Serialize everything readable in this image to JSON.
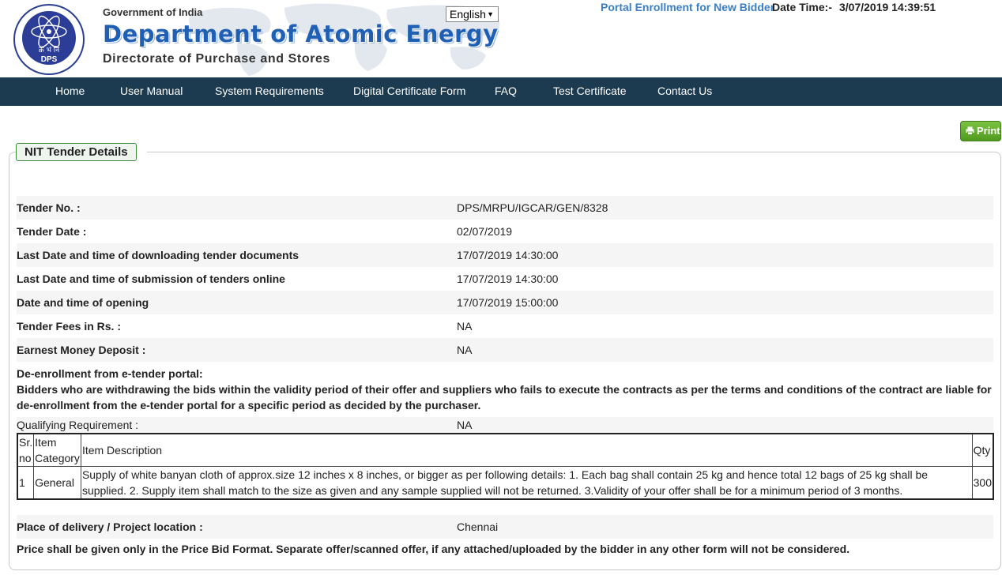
{
  "header": {
    "logo_alt": "DPS",
    "gov_text": "Government of India",
    "dept_title": "Department of Atomic Energy",
    "directorate": "Directorate of Purchase and Stores",
    "language": "English",
    "enrollment_link": "Portal Enrollment for New Bidder",
    "date_time_label": "Date Time:-",
    "date_time_value": "3/07/2019 14:39:51"
  },
  "nav": [
    "Home",
    "User Manual",
    "System Requirements",
    "Digital Certificate Form",
    "FAQ",
    "Test Certificate",
    "Contact Us"
  ],
  "print_label": "Print",
  "panel_title": "NIT Tender Details",
  "details": [
    {
      "label": "Tender No. :",
      "value": "DPS/MRPU/IGCAR/GEN/8328"
    },
    {
      "label": "Tender Date :",
      "value": "02/07/2019"
    },
    {
      "label": "Last Date and time of downloading tender documents",
      "value": "17/07/2019 14:30:00"
    },
    {
      "label": "Last Date and time of submission of tenders online",
      "value": "17/07/2019 14:30:00"
    },
    {
      "label": "Date and time of opening",
      "value": "17/07/2019 15:00:00"
    },
    {
      "label": "Tender Fees in Rs. :",
      "value": "NA"
    },
    {
      "label": "Earnest Money Deposit :",
      "value": "NA"
    }
  ],
  "deenrollment_title": "De-enrollment from e-tender portal:",
  "deenrollment_text": "Bidders who are withdrawing the bids within the validity period of their offer and suppliers who fails to execute the contracts as per the terms and conditions of the contract are liable for de-enrollment from the e-tender portal for a specific period as decided by the purchaser.",
  "qualifying": {
    "label": "Qualifying Requirement :",
    "value": "NA"
  },
  "items_table": {
    "headers": [
      "Sr. no",
      "Item Category",
      "Item Description",
      "Qty"
    ],
    "rows": [
      {
        "sr": "1",
        "category": "General",
        "description": "Supply of white banyan cloth of approx.size 12 inches x 8 inches, or bigger as per following details: 1. Each bag shall contain 25 kg and hence total 12 bags of 25 kg shall be supplied. 2. Supply item shall match to the size as given and any sample supplied will not be returned. 3.Validity of your offer shall be for a minimum period of 3 months.",
        "qty": "300"
      }
    ]
  },
  "delivery": {
    "label": "Place of delivery / Project location :",
    "value": "Chennai"
  },
  "price_note": "Price shall be given only in the Price Bid Format. Separate offer/scanned offer, if any attached/uploaded by the bidder in any other form will not be considered.",
  "colors": {
    "nav_bg": "#1c3b50",
    "title_blue": "#1f5fb4",
    "link_blue": "#3a7fc4",
    "print_green": "#5faa2b",
    "legend_border": "#3b8a3b"
  }
}
